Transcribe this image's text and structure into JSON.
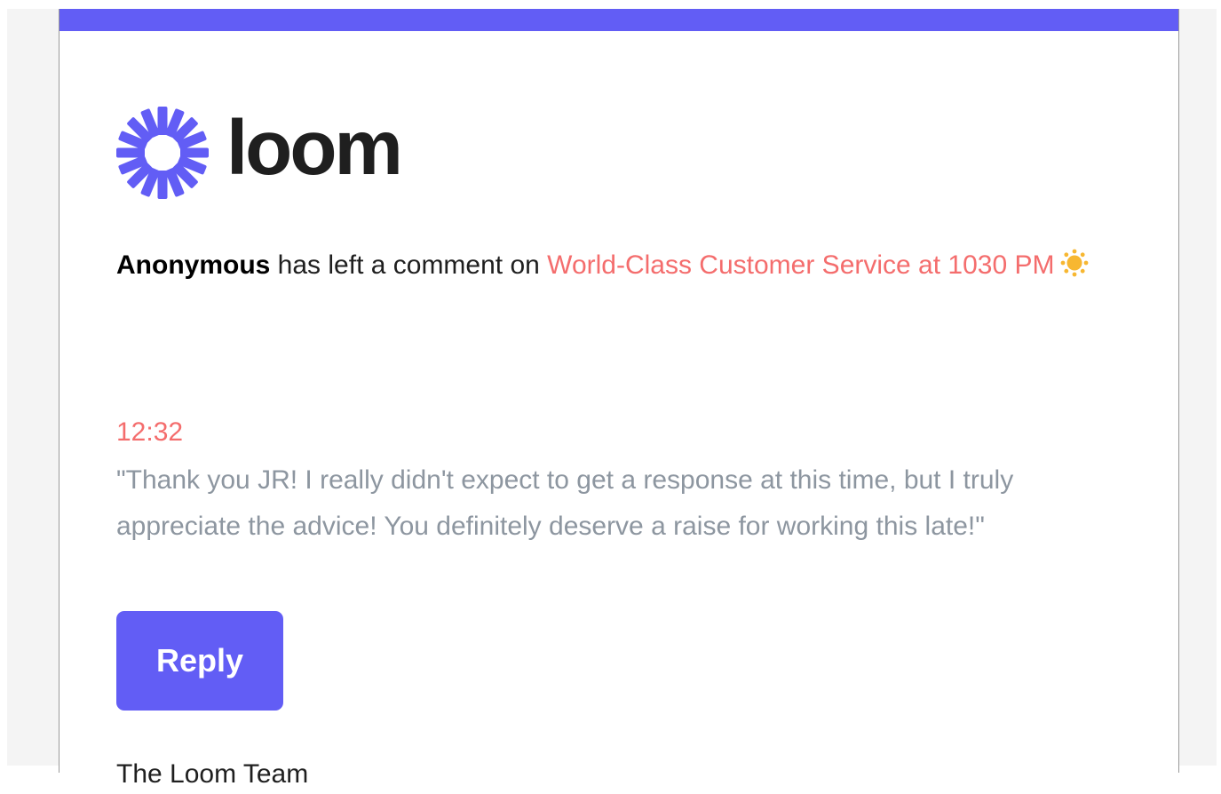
{
  "colors": {
    "brand": "#625df5",
    "link": "#f46d6d",
    "comment_text": "#8d96a0",
    "sun": "#f7b731"
  },
  "logo": {
    "icon": "loom-burst-icon",
    "wordmark": "loom"
  },
  "notification": {
    "author": "Anonymous",
    "action_text": " has left a comment on ",
    "video_title": "World-Class Customer Service at 1030 PM",
    "emoji_icon": "sun-icon"
  },
  "comment": {
    "timestamp": "12:32",
    "text": "\"Thank you JR! I really didn't expect to get a response at this time, but I truly appreciate the advice! You definitely deserve a raise for working this late!\""
  },
  "reply_button": {
    "label": "Reply"
  },
  "footer": {
    "text": "The Loom Team"
  }
}
